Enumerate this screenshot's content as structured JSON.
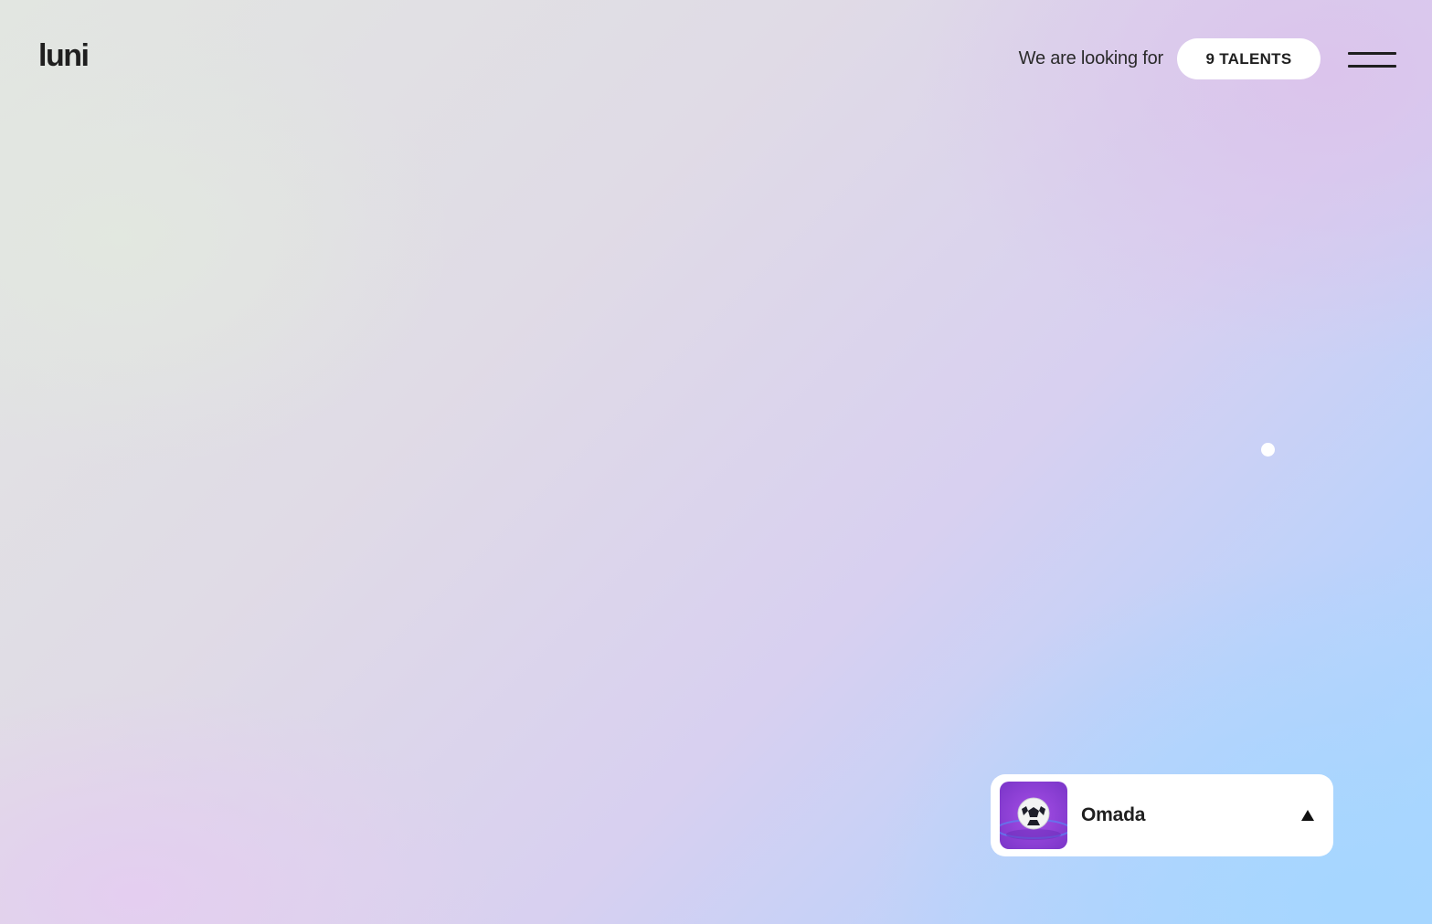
{
  "header": {
    "logo": "luni",
    "looking_for_text": "We are looking for",
    "talents_button_label": "9 TALENTS",
    "menu_icon": "hamburger-menu-icon"
  },
  "player": {
    "title": "Omada",
    "thumbnail_icon": "soccer-ball-icon",
    "toggle_icon": "triangle-up-icon"
  },
  "colors": {
    "text": "#1f1f1f",
    "card_background": "#ffffff",
    "gradient_start": "#e2e6e1",
    "gradient_mid": "#d8d0f0",
    "gradient_end": "#a8d6ff",
    "thumbnail_purple": "#8f3fd6"
  }
}
